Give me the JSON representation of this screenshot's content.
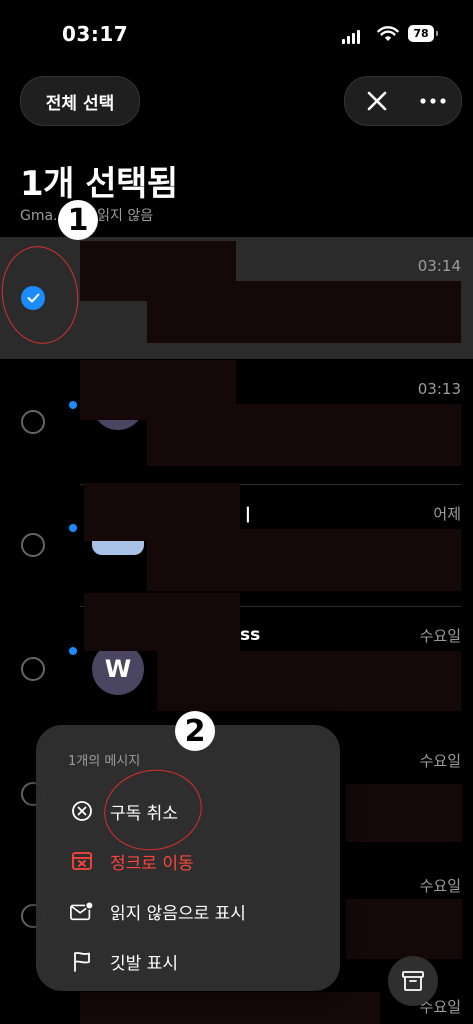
{
  "status_bar": {
    "time": "03:17",
    "battery": "78"
  },
  "header": {
    "select_all": "전체 선택",
    "title": "1개 선택됨",
    "subtitle": "Gma... 3개 읽지 않음"
  },
  "emails": [
    {
      "time": "03:14",
      "selected": true,
      "unread": false
    },
    {
      "time": "03:13",
      "selected": false,
      "unread": true
    },
    {
      "time": "어제",
      "selected": false,
      "unread": true,
      "sender_partial": "ㅣ"
    },
    {
      "time": "수요일",
      "selected": false,
      "unread": true,
      "sender_partial": "ss",
      "avatar_letter": "W"
    },
    {
      "time": "수요일",
      "selected": false,
      "unread": false
    },
    {
      "time": "수요일",
      "selected": false,
      "unread": false
    },
    {
      "time": "수요일",
      "selected": false,
      "unread": false
    }
  ],
  "context_menu": {
    "header": "1개의 메시지",
    "items": [
      {
        "label": "구독 취소",
        "icon": "unsubscribe-icon",
        "color": "#ffffff"
      },
      {
        "label": "정크로 이동",
        "icon": "junk-icon",
        "color": "#ff453a"
      },
      {
        "label": "읽지 않음으로 표시",
        "icon": "mark-unread-icon",
        "color": "#ffffff"
      },
      {
        "label": "깃발 표시",
        "icon": "flag-icon",
        "color": "#ffffff"
      }
    ]
  },
  "annotations": {
    "one": "1",
    "two": "2"
  },
  "colors": {
    "accent": "#1a8cff",
    "destructive": "#ff453a",
    "annotation": "#d9302a"
  }
}
